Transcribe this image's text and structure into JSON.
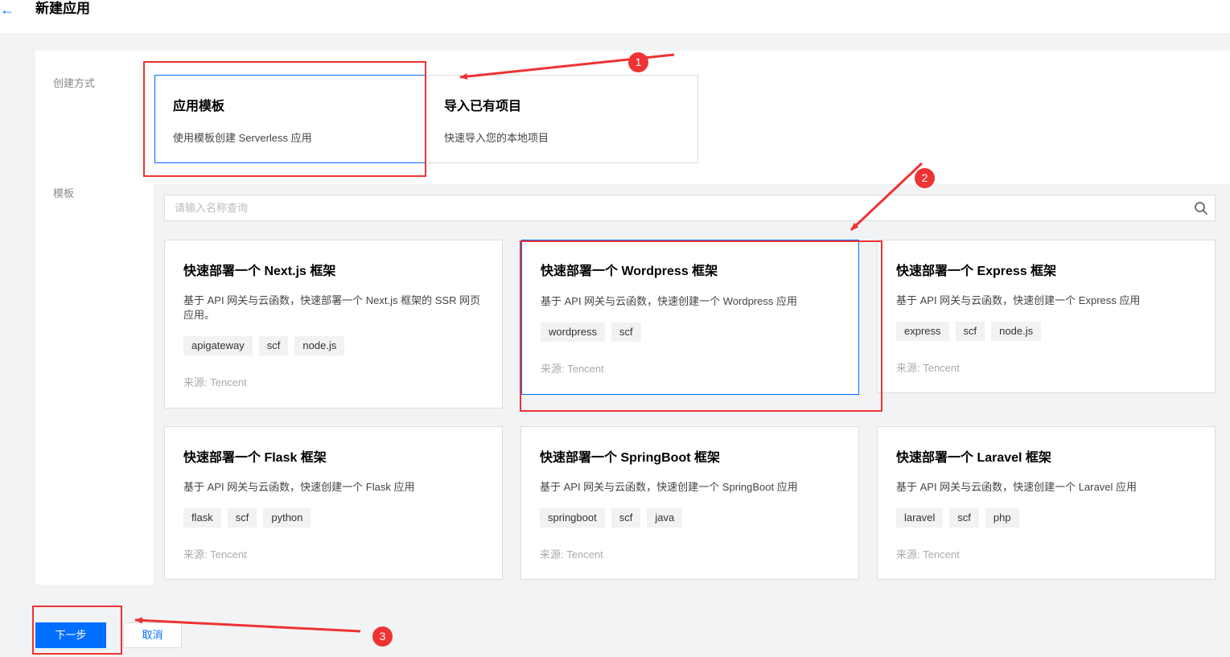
{
  "header": {
    "title": "新建应用"
  },
  "form": {
    "mode_label": "创建方式",
    "template_label": "模板",
    "modes": [
      {
        "title": "应用模板",
        "desc": "使用模板创建 Serverless 应用"
      },
      {
        "title": "导入已有项目",
        "desc": "快速导入您的本地项目"
      }
    ],
    "search": {
      "placeholder": "请输入名称查询"
    }
  },
  "templates": [
    {
      "title": "快速部署一个 Next.js 框架",
      "desc": "基于 API 网关与云函数，快速部署一个 Next.js 框架的 SSR 网页应用。",
      "tags": [
        "apigateway",
        "scf",
        "node.js"
      ],
      "source": "来源: Tencent"
    },
    {
      "title": "快速部署一个 Wordpress 框架",
      "desc": "基于 API 网关与云函数，快速创建一个 Wordpress 应用",
      "tags": [
        "wordpress",
        "scf"
      ],
      "source": "来源: Tencent"
    },
    {
      "title": "快速部署一个 Express 框架",
      "desc": "基于 API 网关与云函数，快速创建一个 Express 应用",
      "tags": [
        "express",
        "scf",
        "node.js"
      ],
      "source": "来源: Tencent"
    },
    {
      "title": "快速部署一个 Flask 框架",
      "desc": "基于 API 网关与云函数，快速创建一个 Flask 应用",
      "tags": [
        "flask",
        "scf",
        "python"
      ],
      "source": "来源: Tencent"
    },
    {
      "title": "快速部署一个 SpringBoot 框架",
      "desc": "基于 API 网关与云函数，快速创建一个 SpringBoot 应用",
      "tags": [
        "springboot",
        "scf",
        "java"
      ],
      "source": "来源: Tencent"
    },
    {
      "title": "快速部署一个 Laravel 框架",
      "desc": "基于 API 网关与云函数，快速创建一个 Laravel 应用",
      "tags": [
        "laravel",
        "scf",
        "php"
      ],
      "source": "来源: Tencent"
    }
  ],
  "footer": {
    "next_label": "下一步",
    "cancel_label": "取消"
  },
  "annotations": {
    "badge1": "1",
    "badge2": "2",
    "badge3": "3"
  },
  "colors": {
    "accent": "#006eff",
    "annotation": "#e33333"
  },
  "icons": {
    "back": "arrow-left-icon",
    "search": "search-icon"
  }
}
